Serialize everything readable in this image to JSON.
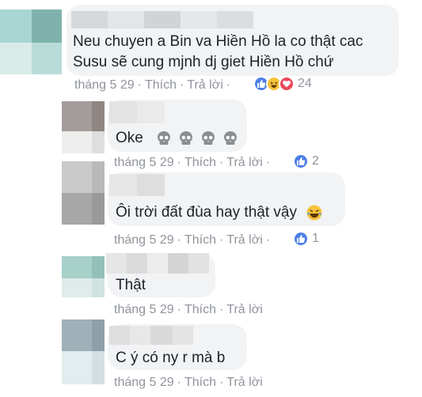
{
  "comments": [
    {
      "text_lines": [
        "Neu chuyen a Bin va Hiền Hồ la co thật cac",
        "Susu sẽ cung mjnh dj giet Hiền Hồ chứ"
      ],
      "time": "tháng 5 29",
      "like_label": "Thích",
      "reply_label": "Trả lời",
      "reaction_icons": [
        "like-icon",
        "haha-icon",
        "love-icon"
      ],
      "reaction_count": "24"
    },
    {
      "text": "Oke",
      "text_emojis": [
        "skull-icon",
        "skull-icon",
        "skull-icon",
        "skull-icon"
      ],
      "time": "tháng 5 29",
      "like_label": "Thích",
      "reply_label": "Trả lời",
      "reaction_icons": [
        "like-icon"
      ],
      "reaction_count": "2"
    },
    {
      "text": "Ôi trời đất đùa hay thật vậy",
      "text_emojis": [
        "laughing-tears-icon"
      ],
      "time": "tháng 5 29",
      "like_label": "Thích",
      "reply_label": "Trả lời",
      "reaction_icons": [
        "like-icon"
      ],
      "reaction_count": "1"
    },
    {
      "text": "Thật",
      "time": "tháng 5 29",
      "like_label": "Thích",
      "reply_label": "Trả lời"
    },
    {
      "text": "C ý có ny r mà b",
      "time": "tháng 5 29",
      "like_label": "Thích",
      "reply_label": "Trả lời"
    }
  ],
  "colors": {
    "meta_text": "#90949c",
    "bubble_bg": "#f2f3f5",
    "like_blue": "#4c7ee6",
    "haha_yellow": "#f7c33b",
    "love_red": "#e8485a"
  }
}
